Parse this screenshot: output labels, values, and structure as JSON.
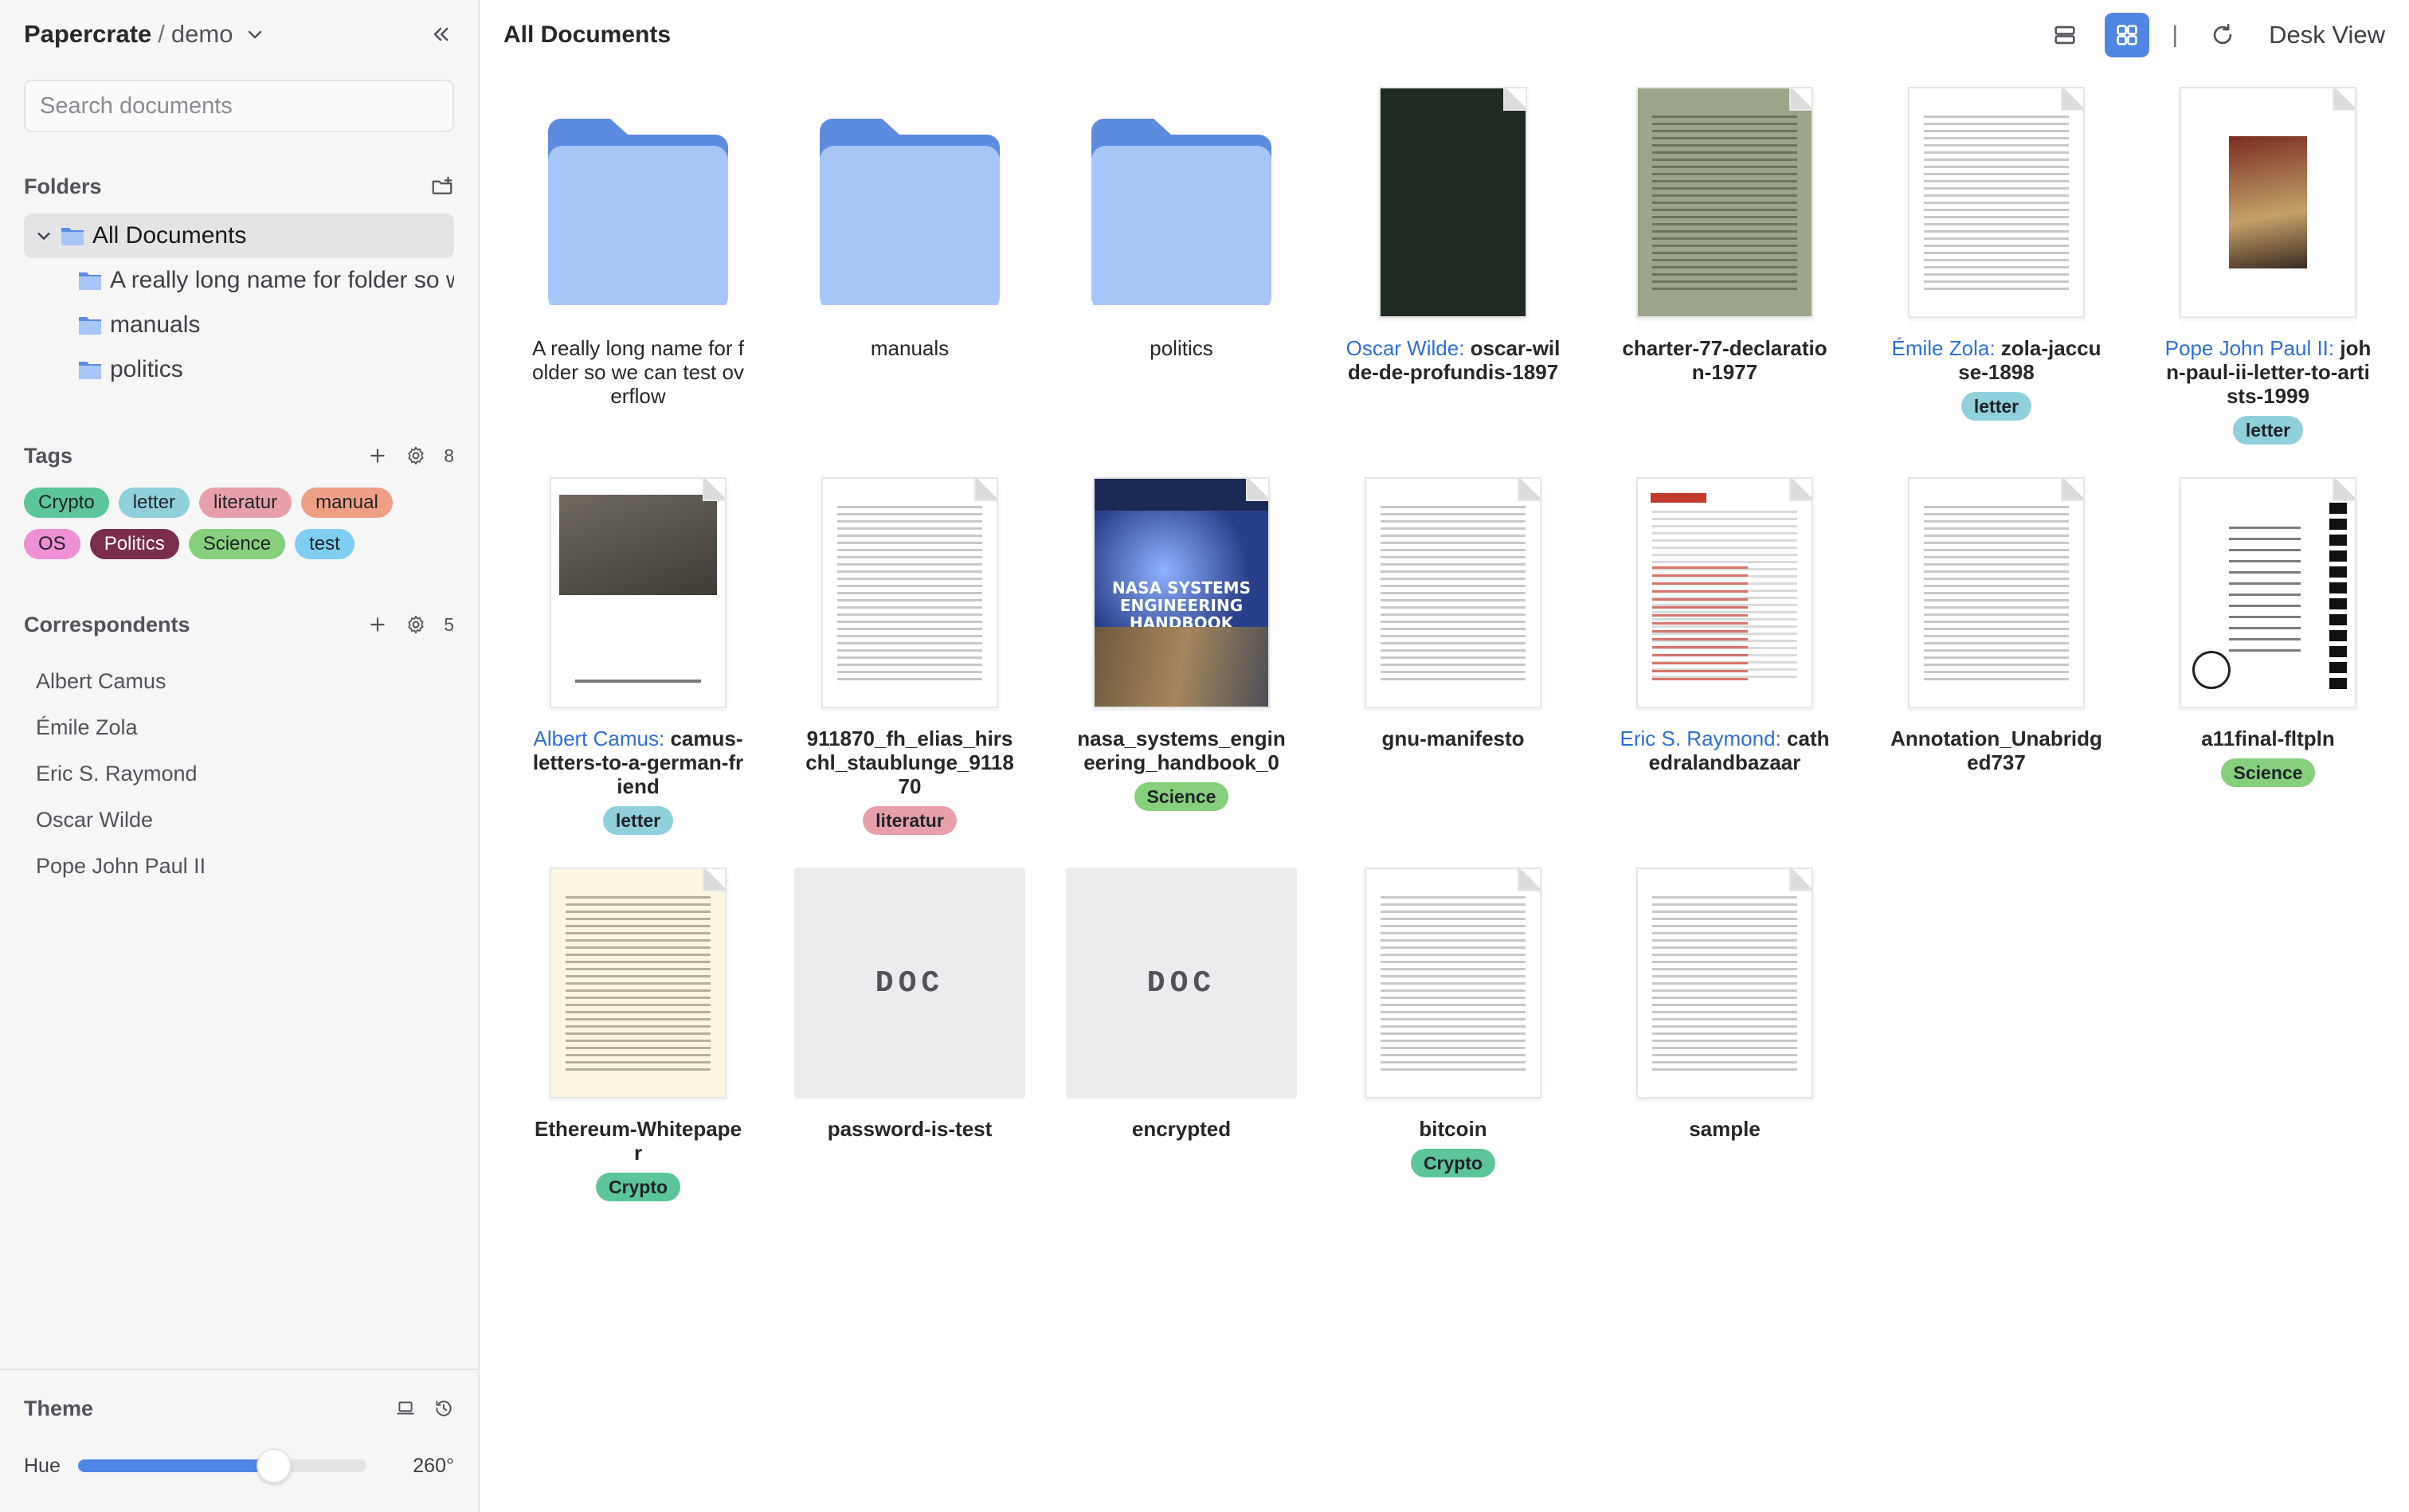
{
  "app": {
    "name": "Papercrate",
    "separator": "/",
    "workspace": "demo"
  },
  "search": {
    "placeholder": "Search documents",
    "value": ""
  },
  "folders_section": {
    "title": "Folders",
    "root": "All Documents",
    "children": [
      "A really long name for folder so we can test overflow",
      "manuals",
      "politics"
    ]
  },
  "tags_section": {
    "title": "Tags",
    "count": "8",
    "items": [
      {
        "label": "Crypto",
        "color": "#5cc59a"
      },
      {
        "label": "letter",
        "color": "#8fd0db"
      },
      {
        "label": "literatur",
        "color": "#e7a0aa"
      },
      {
        "label": "manual",
        "color": "#ef9f86"
      },
      {
        "label": "OS",
        "color": "#ef8fd6"
      },
      {
        "label": "Politics",
        "color": "#7a2e4c",
        "text_color": "#ffffff"
      },
      {
        "label": "Science",
        "color": "#86cf7d"
      },
      {
        "label": "test",
        "color": "#7fcdf0"
      }
    ]
  },
  "correspondents_section": {
    "title": "Correspondents",
    "count": "5",
    "items": [
      "Albert Camus",
      "Émile Zola",
      "Eric S. Raymond",
      "Oscar Wilde",
      "Pope John Paul II"
    ]
  },
  "theme": {
    "title": "Theme",
    "hue_label": "Hue",
    "hue_value": "260°",
    "hue_fraction": 0.68
  },
  "main": {
    "title": "All Documents",
    "separator": "|",
    "desk_view_label": "Desk View"
  },
  "colors": {
    "accent": "#4f86e6",
    "folder_front": "#a8c5f7",
    "folder_back": "#5b8ce0",
    "correspondent": "#2f6fd6"
  },
  "documents": [
    {
      "kind": "folder",
      "title": "A really long name for folder so we can test overflow"
    },
    {
      "kind": "folder",
      "title": "manuals"
    },
    {
      "kind": "folder",
      "title": "politics"
    },
    {
      "kind": "doc",
      "thumb": "dark",
      "correspondent": "Oscar Wilde:",
      "title": "oscar-wilde-de-profundis-1897"
    },
    {
      "kind": "doc",
      "thumb": "olive",
      "title": "charter-77-declaration-1977"
    },
    {
      "kind": "doc",
      "thumb": "text",
      "correspondent": "Émile Zola:",
      "title": "zola-jaccuse-1898",
      "tag": "letter"
    },
    {
      "kind": "doc",
      "thumb": "portrait",
      "correspondent": "Pope John Paul II:",
      "title": "john-paul-ii-letter-to-artists-1999",
      "tag": "letter"
    },
    {
      "kind": "doc",
      "thumb": "photo",
      "correspondent": "Albert Camus:",
      "title": "camus-letters-to-a-german-friend",
      "tag": "letter"
    },
    {
      "kind": "doc",
      "thumb": "text",
      "title": "911870_fh_elias_hirschl_staublunge_911870",
      "tag": "literatur"
    },
    {
      "kind": "doc",
      "thumb": "nasa",
      "title": "nasa_systems_engineering_handbook_0",
      "tag": "Science",
      "cover_text": "NASA SYSTEMS ENGINEERING HANDBOOK"
    },
    {
      "kind": "doc",
      "thumb": "text",
      "title": "gnu-manifesto"
    },
    {
      "kind": "doc",
      "thumb": "red",
      "correspondent": "Eric S. Raymond:",
      "title": "cathedralandbazaar"
    },
    {
      "kind": "doc",
      "thumb": "text",
      "title": "Annotation_Unabridged737"
    },
    {
      "kind": "doc",
      "thumb": "apollo",
      "title": "a11final-fltpln",
      "tag": "Science"
    },
    {
      "kind": "doc",
      "thumb": "cream",
      "title": "Ethereum-Whitepaper",
      "tag": "Crypto"
    },
    {
      "kind": "doc",
      "thumb": "placeholder",
      "placeholder_label": "DOC",
      "title": "password-is-test"
    },
    {
      "kind": "doc",
      "thumb": "placeholder",
      "placeholder_label": "DOC",
      "title": "encrypted"
    },
    {
      "kind": "doc",
      "thumb": "text",
      "title": "bitcoin",
      "tag": "Crypto"
    },
    {
      "kind": "doc",
      "thumb": "text",
      "title": "sample"
    }
  ]
}
